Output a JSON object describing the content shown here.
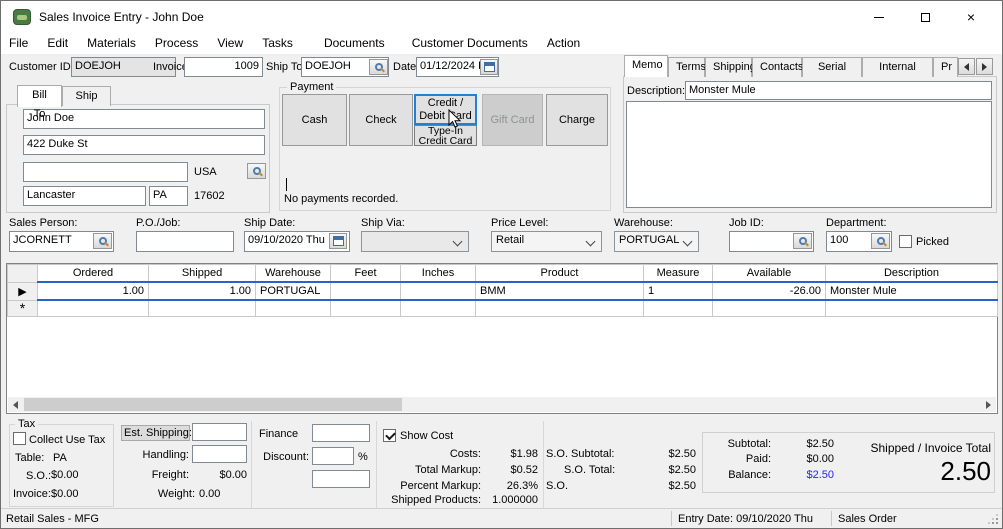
{
  "window": {
    "title": "Sales Invoice Entry - John Doe"
  },
  "menu": {
    "items": [
      "File",
      "Edit",
      "Materials",
      "Process",
      "View",
      "Tasks",
      "Documents",
      "Customer Documents",
      "Action"
    ]
  },
  "header": {
    "customer_id_label": "Customer ID:",
    "customer_id_value": "DOEJOH",
    "invoice_label": "Invoice:",
    "invoice_value": "1009",
    "ship_to_label": "Ship To:",
    "ship_to_value": "DOEJOH",
    "date_label": "Date:",
    "date_value": "01/12/2024 Fri"
  },
  "bill_to": {
    "tab_bill_to": "Bill To",
    "tab_ship_to": "Ship To",
    "name": "John Doe",
    "street": "422 Duke St",
    "line3": "",
    "country": "USA",
    "city": "Lancaster",
    "state": "PA",
    "zip": "17602"
  },
  "payment": {
    "caption": "Payment",
    "cash": "Cash",
    "check": "Check",
    "credit_debit": "Credit / Debit Card",
    "type_in": "Type-In Credit Card",
    "gift_card": "Gift Card",
    "charge": "Charge",
    "no_payments": "No payments recorded."
  },
  "memo_tabs": [
    "Memo",
    "Terms",
    "Shipping",
    "Contacts",
    "Serial No.",
    "Internal Notes",
    "Pr"
  ],
  "memo": {
    "description_label": "Description:",
    "description_value": "Monster Mule",
    "body": ""
  },
  "order": {
    "sales_person_label": "Sales Person:",
    "sales_person_value": "JCORNETT",
    "po_job_label": "P.O./Job:",
    "po_job_value": "",
    "ship_date_label": "Ship Date:",
    "ship_date_value": "09/10/2020 Thu",
    "ship_via_label": "Ship Via:",
    "ship_via_value": "",
    "price_level_label": "Price Level:",
    "price_level_value": "Retail",
    "warehouse_label": "Warehouse:",
    "warehouse_value": "PORTUGAL",
    "job_id_label": "Job ID:",
    "job_id_value": "",
    "department_label": "Department:",
    "department_value": "100",
    "picked_label": "Picked"
  },
  "grid": {
    "columns": [
      "Ordered",
      "Shipped",
      "Warehouse",
      "Feet",
      "Inches",
      "Product",
      "Measure",
      "Available",
      "Description"
    ],
    "rows": [
      {
        "ordered": "1.00",
        "shipped": "1.00",
        "warehouse": "PORTUGAL",
        "feet": "",
        "inches": "",
        "product": "BMM",
        "measure": "1",
        "available": "-26.00",
        "description": "Monster Mule"
      }
    ],
    "new_row_glyph": "*"
  },
  "tax": {
    "caption": "Tax",
    "collect_label": "Collect Use Tax",
    "table_label": "Table:",
    "table_value": "PA",
    "so_label": "S.O.:",
    "so_value": "$0.00",
    "invoice_label": "Invoice:",
    "invoice_value": "$0.00"
  },
  "shipping_costs": {
    "est_shipping_label": "Est. Shipping:",
    "est_shipping_value": "",
    "handling_label": "Handling:",
    "handling_value": "",
    "freight_label": "Freight:",
    "freight_value": "$0.00",
    "weight_label": "Weight:",
    "weight_value": "0.00"
  },
  "finance": {
    "caption": "Finance",
    "finance_value": "",
    "discount_label": "Discount:",
    "discount_value": "",
    "percent_sign": "%",
    "extra_value": ""
  },
  "costs": {
    "show_cost_label": "Show Cost",
    "rows": [
      {
        "label": "Costs:",
        "value": "$1.98"
      },
      {
        "label": "Total Markup:",
        "value": "$0.52"
      },
      {
        "label": "Percent Markup:",
        "value": "26.3%"
      },
      {
        "label": "Shipped Products:",
        "value": "1.000000"
      }
    ]
  },
  "so_totals": {
    "rows": [
      {
        "label": "S.O. Subtotal:",
        "value": "$2.50"
      },
      {
        "label": "S.O. Total:",
        "value": "$2.50"
      },
      {
        "label": "S.O.",
        "value": "$2.50"
      }
    ]
  },
  "summary": {
    "subtotal_label": "Subtotal:",
    "subtotal_value": "$2.50",
    "paid_label": "Paid:",
    "paid_value": "$0.00",
    "balance_label": "Balance:",
    "balance_value": "$2.50",
    "total_label": "Shipped / Invoice Total",
    "total_value": "2.50"
  },
  "status_bar": {
    "left": "Retail Sales - MFG",
    "entry_date": "Entry Date: 09/10/2020 Thu",
    "mode": "Sales Order"
  },
  "colors": {
    "focus": "#1f82d2",
    "row_select": "#2565c7",
    "balance": "#2323ff"
  }
}
